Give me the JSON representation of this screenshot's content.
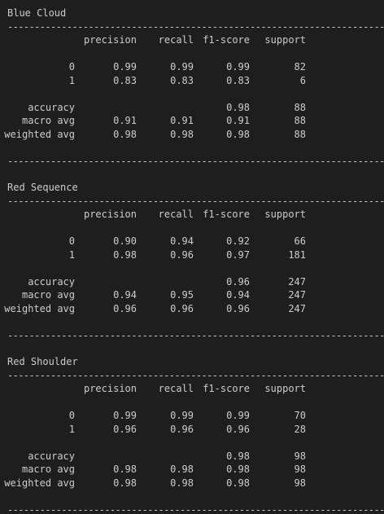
{
  "report_headers": [
    "precision",
    "recall",
    "f1-score",
    "support"
  ],
  "divider": "-----------------------------------------------------------------------------",
  "sections": [
    {
      "title": "Blue Cloud",
      "classes": [
        {
          "label": "0",
          "precision": "0.99",
          "recall": "0.99",
          "f1": "0.99",
          "support": "82"
        },
        {
          "label": "1",
          "precision": "0.83",
          "recall": "0.83",
          "f1": "0.83",
          "support": "6"
        }
      ],
      "accuracy": {
        "label": "accuracy",
        "f1": "0.98",
        "support": "88"
      },
      "macro": {
        "label": "macro avg",
        "precision": "0.91",
        "recall": "0.91",
        "f1": "0.91",
        "support": "88"
      },
      "weighted": {
        "label": "weighted avg",
        "precision": "0.98",
        "recall": "0.98",
        "f1": "0.98",
        "support": "88"
      }
    },
    {
      "title": "Red Sequence",
      "classes": [
        {
          "label": "0",
          "precision": "0.90",
          "recall": "0.94",
          "f1": "0.92",
          "support": "66"
        },
        {
          "label": "1",
          "precision": "0.98",
          "recall": "0.96",
          "f1": "0.97",
          "support": "181"
        }
      ],
      "accuracy": {
        "label": "accuracy",
        "f1": "0.96",
        "support": "247"
      },
      "macro": {
        "label": "macro avg",
        "precision": "0.94",
        "recall": "0.95",
        "f1": "0.94",
        "support": "247"
      },
      "weighted": {
        "label": "weighted avg",
        "precision": "0.96",
        "recall": "0.96",
        "f1": "0.96",
        "support": "247"
      }
    },
    {
      "title": "Red Shoulder",
      "classes": [
        {
          "label": "0",
          "precision": "0.99",
          "recall": "0.99",
          "f1": "0.99",
          "support": "70"
        },
        {
          "label": "1",
          "precision": "0.96",
          "recall": "0.96",
          "f1": "0.96",
          "support": "28"
        }
      ],
      "accuracy": {
        "label": "accuracy",
        "f1": "0.98",
        "support": "98"
      },
      "macro": {
        "label": "macro avg",
        "precision": "0.98",
        "recall": "0.98",
        "f1": "0.98",
        "support": "98"
      },
      "weighted": {
        "label": "weighted avg",
        "precision": "0.98",
        "recall": "0.98",
        "f1": "0.98",
        "support": "98"
      }
    }
  ]
}
